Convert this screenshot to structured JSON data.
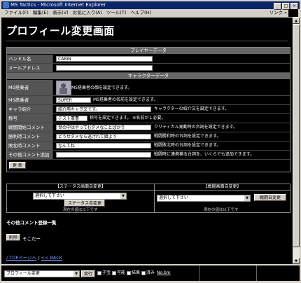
{
  "window": {
    "title": "MS Tactics - Microsoft Internet Explorer",
    "menu": [
      "ファイル(F)",
      "編集(E)",
      "表示(V)",
      "お気に入り(A)",
      "ツール(T)",
      "ヘルプ(H)"
    ],
    "links_label": "リンク »"
  },
  "page": {
    "title": "プロフィール変更画面"
  },
  "player": {
    "header": "プレイヤーデータ",
    "handle_label": "ハンドル名",
    "handle_value": "CABIN",
    "mail_label": "メールアドレス",
    "mail_value": ""
  },
  "character": {
    "header": "キャラクターデータ",
    "pilot_label": "MS搭乗者",
    "pilot_note": "MS搭乗者の顔を設定できます。",
    "pilot_name_label": "MS搭乗者",
    "pilot_name_value": "SUPER",
    "pilot_name_note": "MS搭乗者の名前を設定できます。",
    "intro_label": "キャラ紹介",
    "intro_value": "紹介用キャラ文です。",
    "intro_note": "キャラクターの紹介文を設定できます。",
    "title_label": "称号",
    "title_value": "テスト軍曹",
    "title_note": "称号を設定できます。 ※名前が１必要。",
    "battle_start_label": "戦闘開始コメント",
    "battle_start_value": "世の中はやっても夕メなことばかり",
    "battle_start_note": "クリティカル発動時の台詞を設定できます。",
    "win_label": "勝利時コメント",
    "win_value": "どうせタメなら逃げれて錯よう",
    "win_note": "戦闘勝利時の台詞を設定できます。",
    "lose_label": "敗北時コメント",
    "lose_value": "なんてね",
    "lose_note": "戦闘敗北時の台詞を設定できます。",
    "other_label": "その他コメント追加",
    "other_value": "",
    "other_note": "戦闘時に連携補る台詞を、いくらでも追加できます。",
    "update_button": "更 新"
  },
  "status_change": {
    "header": "【ステータス画面自変更】",
    "select_value": "選択して下さい",
    "button": "ステータス自変更",
    "current": "現在の値は以下です"
  },
  "battle_change": {
    "header": "【戦闘画面自変更】",
    "select_value": "選択して下さい",
    "button": "戦闘自変更",
    "current": "現在の値は以下です"
  },
  "comments": {
    "section_title": "その他コメント登録一覧",
    "delete_button": "削除",
    "item_text": "そこだー"
  },
  "footer_links": {
    "top": "/ TOPページへ",
    "sep": "/",
    "back": "<< BACK"
  },
  "statusbar": {
    "select_value": "プロフィール変更",
    "go_button": "実行",
    "checks": [
      "子宝",
      "可能",
      "結果",
      "済み"
    ],
    "link": "No.bm"
  },
  "colors": {
    "titlebar": "#0a246a",
    "page_bg": "#000000",
    "label_bg": "#555555",
    "link": "#7f9fff"
  }
}
